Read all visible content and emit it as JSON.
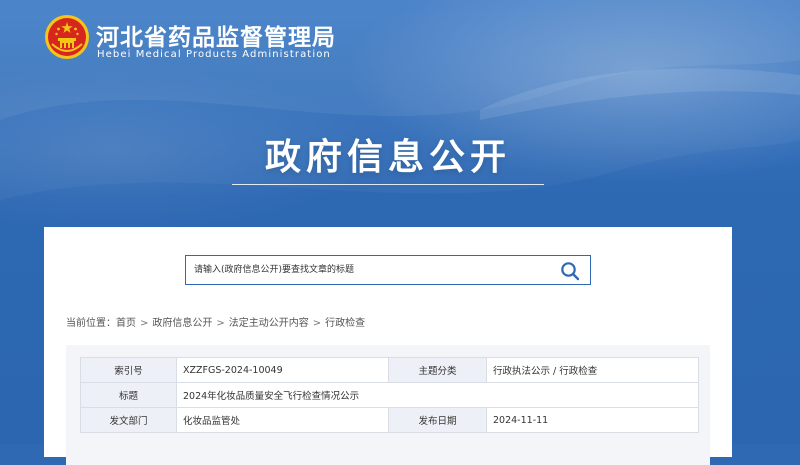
{
  "header": {
    "emblem_icon": "national-emblem-icon",
    "site_name_cn": "河北省药品监督管理局",
    "site_name_en": "Hebei Medical Products Administration"
  },
  "hero": {
    "title": "政府信息公开"
  },
  "search": {
    "placeholder": "请输入(政府信息公开)要查找文章的标题",
    "button_icon": "search-icon"
  },
  "breadcrumb": {
    "prefix": "当前位置：",
    "items": [
      "首页",
      "政府信息公开",
      "法定主动公开内容",
      "行政检查"
    ],
    "separator": ">"
  },
  "info_table": {
    "index_label": "索引号",
    "index_value": "XZZFGS-2024-10049",
    "topic_label": "主题分类",
    "topic_value": "行政执法公示 / 行政检查",
    "title_label": "标题",
    "title_value": "2024年化妆品质量安全飞行检查情况公示",
    "dept_label": "发文部门",
    "dept_value": "化妆品监管处",
    "date_label": "发布日期",
    "date_value": "2024-11-11"
  },
  "colors": {
    "brand_blue": "#2f69b4",
    "emblem_red": "#d7261e",
    "emblem_gold": "#f5c518"
  }
}
